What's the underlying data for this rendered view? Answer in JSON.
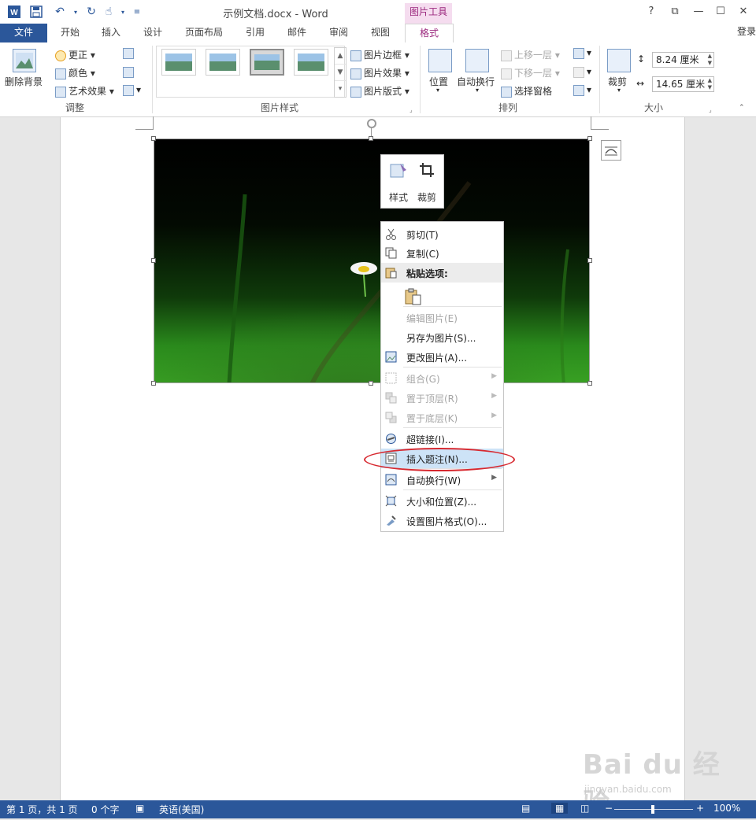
{
  "window": {
    "title": "示例文档.docx - Word",
    "context_tool": "图片工具",
    "help": "?",
    "signin": "登录"
  },
  "quick_access": [
    "word-logo-icon",
    "save-icon",
    "undo-icon",
    "redo-icon",
    "touch-mode-icon",
    "customize-icon"
  ],
  "tabs": [
    {
      "label": "文件"
    },
    {
      "label": "开始"
    },
    {
      "label": "插入"
    },
    {
      "label": "设计"
    },
    {
      "label": "页面布局"
    },
    {
      "label": "引用"
    },
    {
      "label": "邮件"
    },
    {
      "label": "审阅"
    },
    {
      "label": "视图"
    },
    {
      "label": "格式"
    }
  ],
  "ribbon": {
    "adjust": {
      "remove_bg": "删除背景",
      "corrections": "更正",
      "color": "颜色",
      "artistic": "艺术效果",
      "label": "调整"
    },
    "styles": {
      "border": "图片边框",
      "effects": "图片效果",
      "layout": "图片版式",
      "label": "图片样式"
    },
    "arrange": {
      "position": "位置",
      "wrap": "自动换行",
      "forward": "上移一层",
      "backward": "下移一层",
      "selection_pane": "选择窗格",
      "label": "排列"
    },
    "size": {
      "crop": "裁剪",
      "height": "8.24 厘米",
      "width": "14.65 厘米",
      "label": "大小"
    }
  },
  "mini_toolbar": {
    "style": "样式",
    "crop": "裁剪"
  },
  "context_menu": {
    "cut": "剪切(T)",
    "copy": "复制(C)",
    "paste_options": "粘贴选项:",
    "edit_picture": "编辑图片(E)",
    "save_as_picture": "另存为图片(S)...",
    "change_picture": "更改图片(A)...",
    "group": "组合(G)",
    "bring_to_front": "置于顶层(R)",
    "send_to_back": "置于底层(K)",
    "hyperlink": "超链接(I)...",
    "insert_caption": "插入题注(N)...",
    "wrap_text": "自动换行(W)",
    "size_position": "大小和位置(Z)...",
    "format_picture": "设置图片格式(O)..."
  },
  "status": {
    "page": "第 1 页，共 1 页",
    "words": "0 个字",
    "language": "英语(美国)",
    "zoom": "100%"
  },
  "watermark": {
    "main": "Bai du 经验",
    "sub": "jingyan.baidu.com"
  },
  "colors": {
    "brand": "#2b579a",
    "context_tab": "#9c2a7f",
    "highlight": "#d7282f"
  }
}
